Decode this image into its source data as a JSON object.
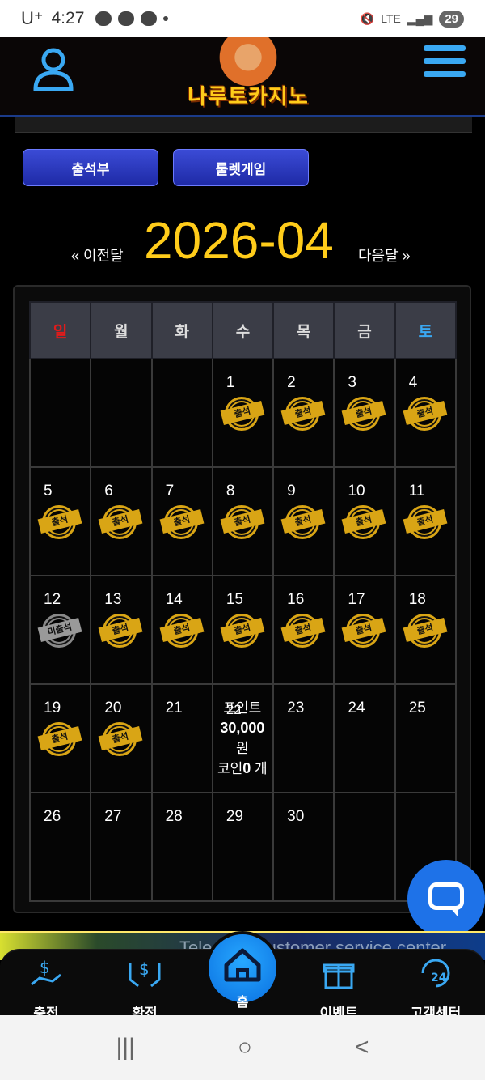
{
  "status_bar": {
    "carrier": "U⁺",
    "time": "4:27",
    "network": "LTE",
    "battery": "29"
  },
  "header": {
    "logo_text": "나루토카지노"
  },
  "tabs": [
    {
      "label": "출석부"
    },
    {
      "label": "룰렛게임"
    }
  ],
  "month_nav": {
    "prev_label": "« 이전달",
    "current": "2026-04",
    "next_label": "다음달 »"
  },
  "calendar": {
    "weekdays": [
      "일",
      "월",
      "화",
      "수",
      "목",
      "금",
      "토"
    ],
    "colors": {
      "sunday": "#e01b1b",
      "saturday": "#3aa8f2",
      "stamp": "#d9a515",
      "missed": "#999999"
    },
    "stamp_label": "출석",
    "missed_label": "미출석",
    "weeks": [
      [
        {
          "day": ""
        },
        {
          "day": ""
        },
        {
          "day": ""
        },
        {
          "day": "1",
          "stamp": "출석"
        },
        {
          "day": "2",
          "stamp": "출석"
        },
        {
          "day": "3",
          "stamp": "출석"
        },
        {
          "day": "4",
          "stamp": "출석"
        }
      ],
      [
        {
          "day": "5",
          "stamp": "출석"
        },
        {
          "day": "6",
          "stamp": "출석"
        },
        {
          "day": "7",
          "stamp": "출석"
        },
        {
          "day": "8",
          "stamp": "출석"
        },
        {
          "day": "9",
          "stamp": "출석"
        },
        {
          "day": "10",
          "stamp": "출석"
        },
        {
          "day": "11",
          "stamp": "출석"
        }
      ],
      [
        {
          "day": "12",
          "stamp": "미출석"
        },
        {
          "day": "13",
          "stamp": "출석"
        },
        {
          "day": "14",
          "stamp": "출석"
        },
        {
          "day": "15",
          "stamp": "출석"
        },
        {
          "day": "16",
          "stamp": "출석"
        },
        {
          "day": "17",
          "stamp": "출석"
        },
        {
          "day": "18",
          "stamp": "출석"
        }
      ],
      [
        {
          "day": "19",
          "stamp": "출석"
        },
        {
          "day": "20",
          "stamp": "출석"
        },
        {
          "day": "21"
        },
        {
          "day": "22",
          "info": true
        },
        {
          "day": "23"
        },
        {
          "day": "24"
        },
        {
          "day": "25"
        }
      ],
      [
        {
          "day": "26"
        },
        {
          "day": "27"
        },
        {
          "day": "28"
        },
        {
          "day": "29"
        },
        {
          "day": "30"
        },
        {
          "day": ""
        },
        {
          "day": ""
        }
      ]
    ],
    "today_info": {
      "point_label": "포인트",
      "point_amount": "30,000",
      "point_unit": "원",
      "coin_label": "코인",
      "coin_amount": "0",
      "coin_unit": "개"
    }
  },
  "marquee": {
    "text": "Telegram customer service center"
  },
  "bottom_nav": {
    "items": [
      {
        "label": "충전",
        "icon": "deposit-icon"
      },
      {
        "label": "환전",
        "icon": "withdraw-icon"
      },
      {
        "label": "홈",
        "icon": "home-icon"
      },
      {
        "label": "이벤트",
        "icon": "gift-icon"
      },
      {
        "label": "고객센터",
        "icon": "support-24-icon"
      }
    ]
  },
  "system_nav": {
    "recent": "|||",
    "home": "○",
    "back": "<"
  }
}
